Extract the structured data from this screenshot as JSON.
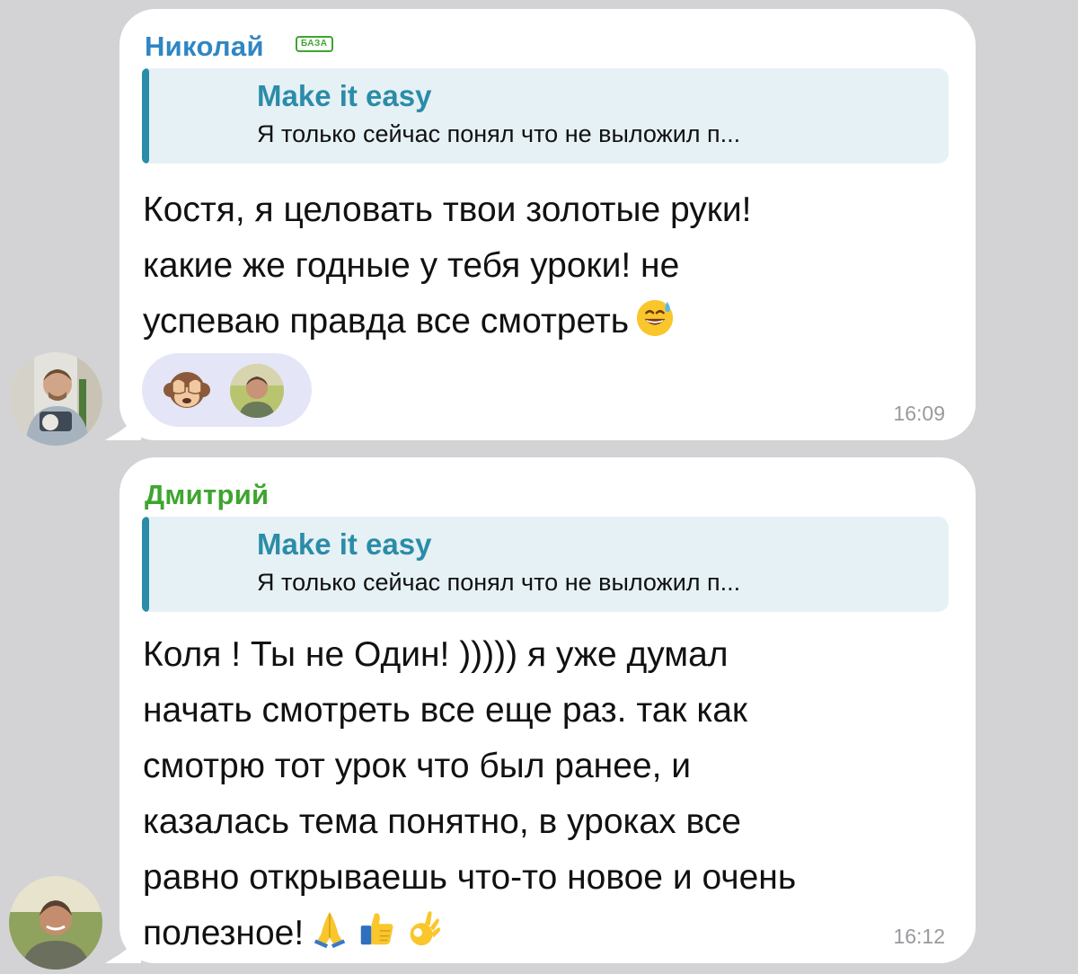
{
  "messages": [
    {
      "sender": "Николай",
      "tag": "БАЗА",
      "reply": {
        "title": "Make it easy",
        "text": "Я только сейчас понял что не выложил п..."
      },
      "text": "Костя, я целовать твои золотые руки!\nкакие же годные у тебя уроки! не\nуспеваю правда все смотреть",
      "emojis": [
        "grinning-sweat-emoji"
      ],
      "reactions": [
        {
          "emoji": "see-no-evil-monkey-emoji"
        }
      ],
      "time": "16:09"
    },
    {
      "sender": "Дмитрий",
      "reply": {
        "title": "Make it easy",
        "text": "Я только сейчас понял что не выложил п..."
      },
      "text": "Коля !  Ты не Один! )))))  я уже думал\nначать смотреть все еще раз. так как\nсмотрю тот урок что был ранее, и\nказалась тема понятно, в уроках  все\nравно открываешь что-то новое и очень\nполезное!",
      "emojis": [
        "folded-hands-emoji",
        "thumbs-up-emoji",
        "ok-hand-emoji"
      ],
      "time": "16:12"
    }
  ],
  "colors": {
    "background": "#d3d3d5",
    "bubble": "#ffffff",
    "sender1": "#2f86c4",
    "sender2": "#3ea52f",
    "reply_accent": "#2b8ca8",
    "reply_bg": "#e6f1f5",
    "time": "#9a9a9e"
  }
}
